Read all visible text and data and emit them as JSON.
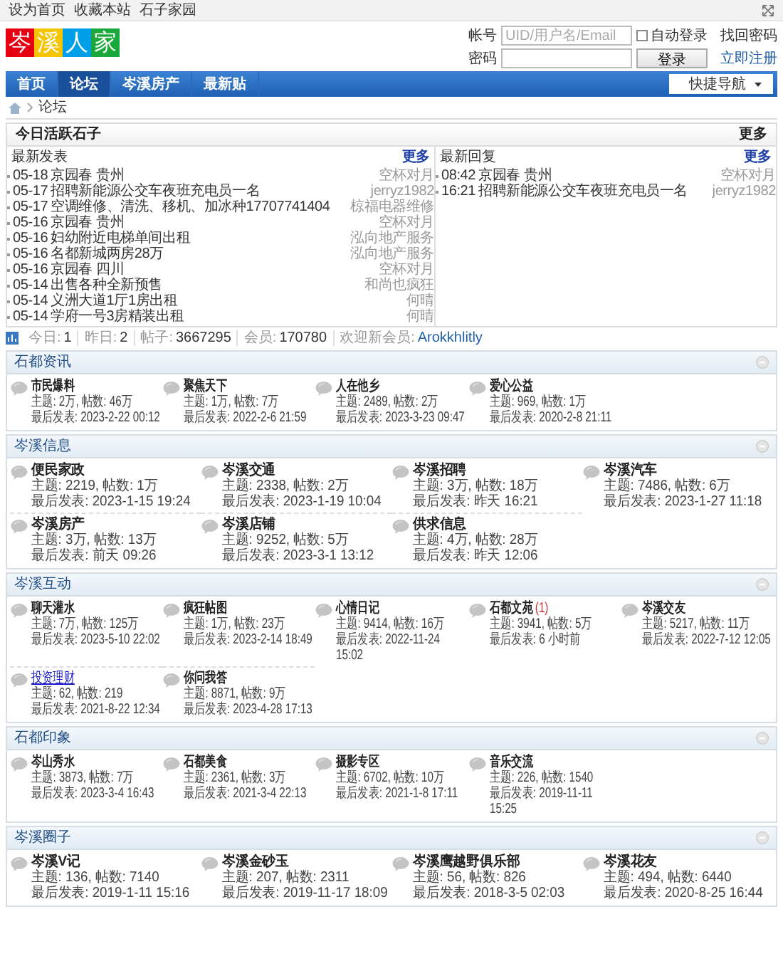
{
  "top_links": [
    "设为首页",
    "收藏本站",
    "石子家园"
  ],
  "logo": [
    {
      "char": "岑",
      "color": "#e60012"
    },
    {
      "char": "溪",
      "color": "#f5c400"
    },
    {
      "char": "人",
      "color": "#00a0e9"
    },
    {
      "char": "家",
      "color": "#1aa83a"
    }
  ],
  "login": {
    "account_label": "帐号",
    "account_placeholder": "UID/用户名/Email",
    "auto_login": {
      "label": "自动登录",
      "checked": false
    },
    "password_label": "密码",
    "login_button": "登录",
    "links": [
      "找回密码",
      "立即注册"
    ]
  },
  "nav": {
    "items": [
      {
        "label": "首页",
        "selected": false
      },
      {
        "label": "论坛",
        "selected": true
      },
      {
        "label": "岑溪房产",
        "selected": false
      },
      {
        "label": "最新贴",
        "selected": false
      }
    ],
    "quick_nav": "快捷导航"
  },
  "breadcrumb": "论坛",
  "active_bar": {
    "title": "今日活跃石子",
    "more": "更多"
  },
  "latest": [
    {
      "title": "最新发表",
      "more": "更多",
      "items": [
        {
          "date": "05-18",
          "title": "京园春 贵州",
          "author": "空杯对月"
        },
        {
          "date": "05-17",
          "title": "招聘新能源公交车夜班充电员一名",
          "author": "jerryz1982"
        },
        {
          "date": "05-17",
          "title": "空调维修、清洗、移机、加冰种17707741404",
          "author": "椋福电器维修"
        },
        {
          "date": "05-16",
          "title": "京园春 贵州",
          "author": "空杯对月"
        },
        {
          "date": "05-16",
          "title": "妇幼附近电梯单间出租",
          "author": "泓向地产服务"
        },
        {
          "date": "05-16",
          "title": "名都新城两房28万",
          "author": "泓向地产服务"
        },
        {
          "date": "05-16",
          "title": "京园春 四川",
          "author": "空杯对月"
        },
        {
          "date": "05-14",
          "title": "出售各种全新预售",
          "author": "和尚也疯狂"
        },
        {
          "date": "05-14",
          "title": "义洲大道1厅1房出租",
          "author": "何晴"
        },
        {
          "date": "05-14",
          "title": "学府一号3房精装出租",
          "author": "何晴"
        }
      ]
    },
    {
      "title": "最新回复",
      "more": "更多",
      "items": [
        {
          "date": "08:42",
          "title": "京园春 贵州",
          "author": "空杯对月"
        },
        {
          "date": "16:21",
          "title": "招聘新能源公交车夜班充电员一名",
          "author": "jerryz1982"
        }
      ]
    }
  ],
  "stats": {
    "items": [
      {
        "label": "今日:",
        "value": "1"
      },
      {
        "label": "昨日:",
        "value": "2"
      },
      {
        "label": "帖子:",
        "value": "3667295"
      },
      {
        "label": "会员:",
        "value": "170780"
      }
    ],
    "welcome_label": "欢迎新会员:",
    "new_member": "Arokkhlitly"
  },
  "sections": [
    {
      "title": "石都资讯",
      "kind": "five",
      "forums": [
        {
          "name": "市民爆料",
          "highlight": false,
          "counts": "主题: 2万, 帖数: 46万",
          "last": "最后发表: 2023-2-22 00:12"
        },
        {
          "name": "聚焦天下",
          "highlight": false,
          "counts": "主题: 1万, 帖数: 7万",
          "last": "最后发表: 2022-2-6 21:59"
        },
        {
          "name": "人在他乡",
          "highlight": false,
          "counts": "主题: 2489, 帖数: 2万",
          "last": "最后发表: 2023-3-23 09:47"
        },
        {
          "name": "爱心公益",
          "highlight": false,
          "counts": "主题: 969, 帖数: 1万",
          "last": "最后发表: 2020-2-8 21:11"
        }
      ]
    },
    {
      "title": "岑溪信息",
      "kind": "four",
      "forums": [
        {
          "name": "便民家政",
          "highlight": false,
          "counts": "主题: 2219, 帖数: 1万",
          "last": "最后发表: 2023-1-15 19:24"
        },
        {
          "name": "岑溪交通",
          "highlight": false,
          "counts": "主题: 2338, 帖数: 2万",
          "last": "最后发表: 2023-1-19 10:04"
        },
        {
          "name": "岑溪招聘",
          "highlight": false,
          "counts": "主题: 3万, 帖数: 18万",
          "last": "最后发表: 昨天 16:21"
        },
        {
          "name": "岑溪汽车",
          "highlight": false,
          "counts": "主题: 7486, 帖数: 6万",
          "last": "最后发表: 2023-1-27 11:18"
        },
        {
          "name": "岑溪房产",
          "highlight": false,
          "counts": "主题: 3万, 帖数: 13万",
          "last": "最后发表: 前天 09:26"
        },
        {
          "name": "岑溪店铺",
          "highlight": false,
          "counts": "主题: 9252, 帖数: 5万",
          "last": "最后发表: 2023-3-1 13:12"
        },
        {
          "name": "供求信息",
          "highlight": false,
          "counts": "主题: 4万, 帖数: 28万",
          "last": "最后发表: 昨天 12:06"
        }
      ]
    },
    {
      "title": "岑溪互动",
      "kind": "five",
      "forums": [
        {
          "name": "聊天灌水",
          "highlight": false,
          "counts": "主题: 7万, 帖数: 125万",
          "last": "最后发表: 2023-5-10 22:02"
        },
        {
          "name": "疯狂帖图",
          "highlight": false,
          "counts": "主题: 1万, 帖数: 23万",
          "last": "最后发表: 2023-2-14 18:49"
        },
        {
          "name": "心情日记",
          "highlight": false,
          "counts": "主题: 9414, 帖数: 16万",
          "last": "最后发表: 2022-11-24 15:02"
        },
        {
          "name": "石都文苑",
          "highlight": false,
          "new_count": "(1)",
          "counts": "主题: 3941, 帖数: 5万",
          "last": "最后发表: 6 小时前"
        },
        {
          "name": "岑溪交友",
          "highlight": false,
          "counts": "主题: 5217, 帖数: 11万",
          "last": "最后发表: 2022-7-12 12:05"
        },
        {
          "name": "投资理财",
          "highlight": true,
          "counts": "主题: 62, 帖数: 219",
          "last": "最后发表: 2021-8-22 12:34"
        },
        {
          "name": "你问我答",
          "highlight": false,
          "counts": "主题: 8871, 帖数: 9万",
          "last": "最后发表: 2023-4-28 17:13"
        }
      ]
    },
    {
      "title": "石都印象",
      "kind": "five",
      "forums": [
        {
          "name": "岑山秀水",
          "highlight": false,
          "counts": "主题: 3873, 帖数: 7万",
          "last": "最后发表: 2023-3-4 16:43"
        },
        {
          "name": "石都美食",
          "highlight": false,
          "counts": "主题: 2361, 帖数: 3万",
          "last": "最后发表: 2021-3-4 22:13"
        },
        {
          "name": "摄影专区",
          "highlight": false,
          "counts": "主题: 6702, 帖数: 10万",
          "last": "最后发表: 2021-1-8 17:11"
        },
        {
          "name": "音乐交流",
          "highlight": false,
          "counts": "主题: 226, 帖数: 1540",
          "last": "最后发表: 2019-11-11 15:25"
        }
      ]
    },
    {
      "title": "岑溪圈子",
      "kind": "four",
      "forums": [
        {
          "name": "岑溪V记",
          "highlight": false,
          "counts": "主题: 136, 帖数: 7140",
          "last": "最后发表: 2019-1-11 15:16"
        },
        {
          "name": "岑溪金砂玉",
          "highlight": false,
          "counts": "主题: 207, 帖数: 2311",
          "last": "最后发表: 2019-11-17 18:09"
        },
        {
          "name": "岑溪鹰越野俱乐部",
          "highlight": false,
          "counts": "主题: 56, 帖数: 826",
          "last": "最后发表: 2018-3-5 02:03"
        },
        {
          "name": "岑溪花友",
          "highlight": false,
          "counts": "主题: 494, 帖数: 6440",
          "last": "最后发表: 2020-8-25 16:44"
        }
      ]
    }
  ]
}
